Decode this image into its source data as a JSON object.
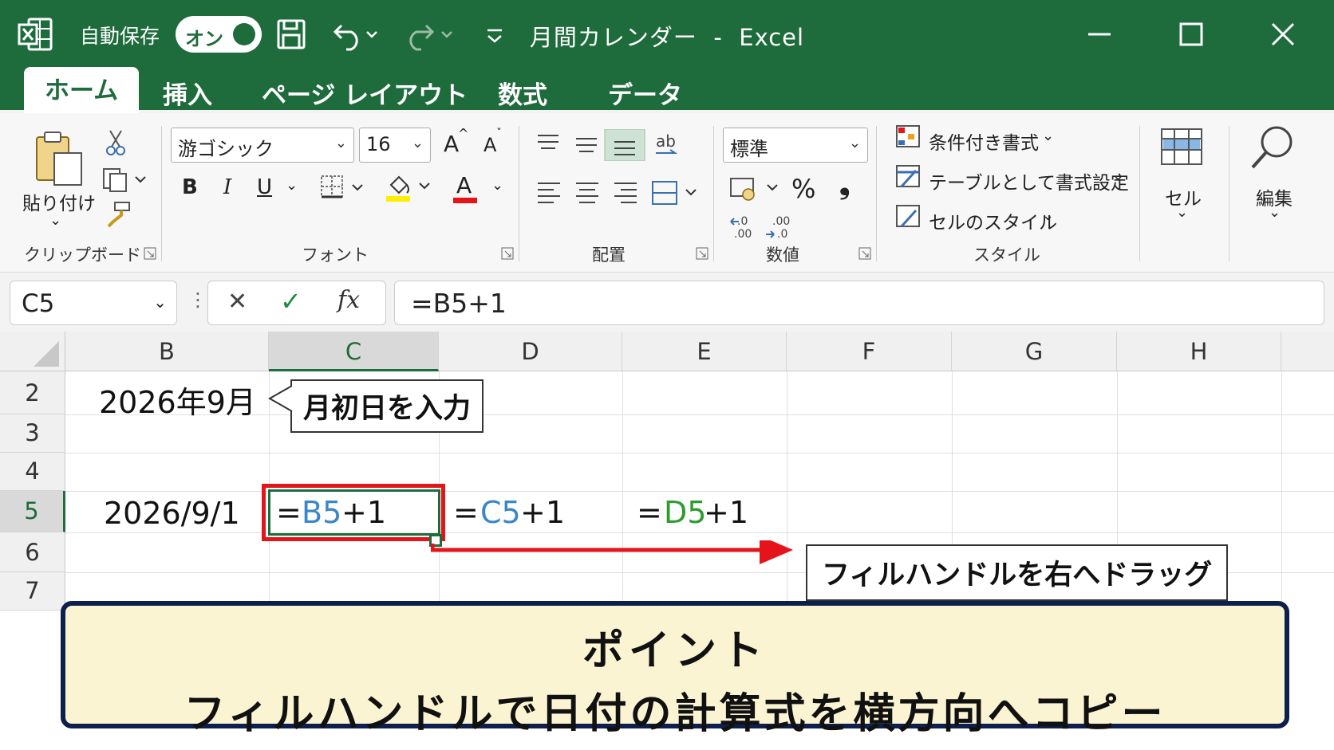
{
  "titlebar": {
    "autosave_label": "自動保存",
    "toggle_label": "オン",
    "window_title": "月間カレンダー  -  Excel"
  },
  "tabs": [
    "ホーム",
    "挿入",
    "ページ レイアウト",
    "数式",
    "データ"
  ],
  "ribbon": {
    "clipboard": {
      "paste_label": "貼り付け",
      "group_label": "クリップボード"
    },
    "font": {
      "font_name": "游ゴシック",
      "font_size": "16",
      "group_label": "フォント",
      "bold": "B",
      "italic": "I",
      "underline": "U",
      "grow": "A",
      "shrink": "A",
      "font_color_letter": "A"
    },
    "alignment": {
      "group_label": "配置"
    },
    "number": {
      "format": "標準",
      "percent": "%",
      "comma": "❟",
      "group_label": "数値"
    },
    "styles": {
      "conditional": "条件付き書式",
      "as_table": "テーブルとして書式設定",
      "cell_styles": "セルのスタイル",
      "group_label": "スタイル"
    },
    "cells": {
      "label": "セル"
    },
    "editing": {
      "label": "編集"
    }
  },
  "formula_bar": {
    "name_box": "C5",
    "cancel": "✕",
    "enter": "✓",
    "fx": "fx",
    "formula": "=B5+1"
  },
  "grid": {
    "columns": [
      "B",
      "C",
      "D",
      "E",
      "F",
      "G",
      "H"
    ],
    "rows": [
      "2",
      "3",
      "4",
      "5",
      "6",
      "7"
    ],
    "cells": {
      "b2": "2026年9月",
      "b5": "2026/9/1",
      "c5_eq": "=",
      "c5_ref": "B5",
      "c5_rest": "+1",
      "d5_eq": "=",
      "d5_ref": "C5",
      "d5_rest": "+1",
      "e5_eq": "=",
      "e5_ref": "D5",
      "e5_rest": "+1"
    }
  },
  "callouts": {
    "first_day": "月初日を入力",
    "drag": "フィルハンドルを右へドラッグ"
  },
  "point": {
    "title": "ポイント",
    "text": "フィルハンドルで日付の計算式を横方向へコピー"
  },
  "colors": {
    "excel_green": "#1e6b3c",
    "ref_blue": "#3a86c8",
    "ref_green": "#2f9b2f",
    "highlight_red": "#e4141a",
    "point_bg": "#fbf4d2",
    "point_border": "#0e1f4d"
  }
}
